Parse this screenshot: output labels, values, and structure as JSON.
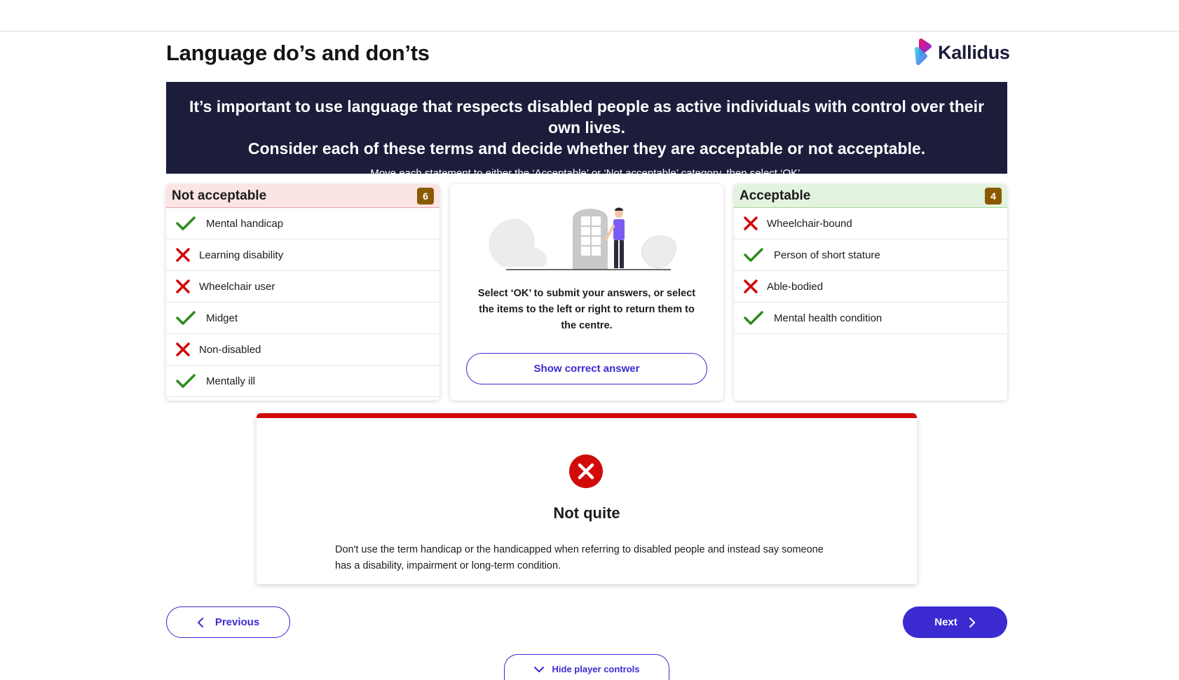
{
  "page": {
    "title": "Language do’s and don’ts",
    "logo_text": "Kallidus"
  },
  "banner": {
    "heading_line1": "It’s important to use language that respects disabled people as active individuals with control over their own lives.",
    "heading_line2": "Consider each of these terms and decide whether they are acceptable or not acceptable.",
    "instruction": "Move each statement to either the ‘Acceptable’ or ‘Not acceptable’ category, then select ‘OK’."
  },
  "not_acceptable": {
    "label": "Not acceptable",
    "count": "6",
    "items": [
      {
        "text": "Mental handicap",
        "mark": "check"
      },
      {
        "text": "Learning disability",
        "mark": "cross"
      },
      {
        "text": "Wheelchair user",
        "mark": "cross"
      },
      {
        "text": "Midget",
        "mark": "check"
      },
      {
        "text": "Non-disabled",
        "mark": "cross"
      },
      {
        "text": "Mentally ill",
        "mark": "check"
      }
    ]
  },
  "center": {
    "illustration": "person-at-door-illustration",
    "instruction": "Select ‘OK’ to submit your answers, or select the items to the left or right to return them to the centre.",
    "show_answer_label": "Show correct answer"
  },
  "acceptable": {
    "label": "Acceptable",
    "count": "4",
    "items": [
      {
        "text": "Wheelchair-bound",
        "mark": "cross"
      },
      {
        "text": "Person of short stature",
        "mark": "check"
      },
      {
        "text": "Able-bodied",
        "mark": "cross"
      },
      {
        "text": "Mental health condition",
        "mark": "check"
      }
    ]
  },
  "feedback": {
    "icon": "error-circle-icon",
    "title": "Not quite",
    "text": "Don't use the term handicap or the handicapped when referring to disabled people and instead say someone has a disability, impairment or long-term condition."
  },
  "nav": {
    "previous_label": "Previous",
    "next_label": "Next",
    "hide_controls_label": "Hide player controls"
  },
  "colors": {
    "banner_bg": "#1c1d3b",
    "accent": "#3b2bd1",
    "correct": "#2e8b1f",
    "incorrect": "#d10a0a",
    "badge": "#8a5a00"
  }
}
